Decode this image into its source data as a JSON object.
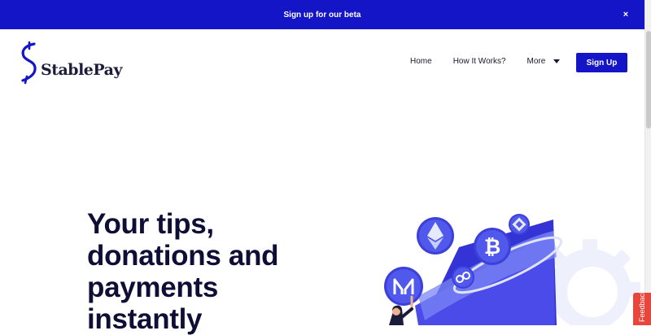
{
  "banner": {
    "text": "Sign up for our beta",
    "close_glyph": "×"
  },
  "brand": {
    "name": "StablePay",
    "logo_icon": "stablepay-s-icon",
    "accent": "#1515c8"
  },
  "nav": {
    "items": [
      {
        "label": "Home"
      },
      {
        "label": "How It Works?"
      },
      {
        "label": "More"
      }
    ],
    "signup_label": "Sign Up"
  },
  "hero": {
    "title_lines": [
      "Your tips,",
      "donations and",
      "payments",
      "instantly"
    ]
  },
  "illustration": {
    "icons": [
      "ethereum-coin-icon",
      "bitcoin-coin-icon",
      "binance-coin-icon",
      "maker-coin-icon",
      "link-coin-icon",
      "gear-icon",
      "funnel-icon",
      "person-icon"
    ]
  },
  "feedback": {
    "label": "Feedback"
  },
  "colors": {
    "brand_blue": "#1515c8",
    "text_dark": "#0e0e36",
    "feedback_red": "#e8453c"
  }
}
